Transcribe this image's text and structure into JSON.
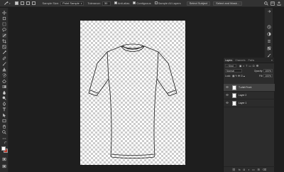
{
  "options_bar": {
    "sample_size_label": "Sample Size:",
    "sample_size_value": "Point Sample",
    "tolerance_label": "Tolerance:",
    "tolerance_value": "30",
    "anti_alias_label": "Anti-alias",
    "contiguous_label": "Contiguous",
    "sample_all_layers_label": "Sample All Layers",
    "select_subject_label": "Select Subject",
    "select_and_mask_label": "Select and Mask..."
  },
  "layers_panel": {
    "tabs": [
      {
        "label": "Layers",
        "active": true
      },
      {
        "label": "Channels",
        "active": false
      },
      {
        "label": "Paths",
        "active": false
      }
    ],
    "filter_kind": "Kind",
    "blend_mode": "Normal",
    "opacity_label": "Opacity:",
    "opacity_value": "100%",
    "lock_label": "Lock:",
    "fill_label": "Fill:",
    "fill_value": "100%",
    "layers": [
      {
        "name": "T-shirt Front",
        "selected": true
      },
      {
        "name": "Layer 2",
        "selected": false
      },
      {
        "name": "Layer 1",
        "selected": false
      }
    ],
    "bottom_icons": [
      "link-icon",
      "fx-icon",
      "mask-icon",
      "adjustment-icon",
      "folder-icon",
      "new-layer-icon",
      "trash-icon"
    ],
    "bottom_glyphs": [
      "⛓",
      "fx",
      "◘",
      "◑",
      "▭",
      "⊞",
      "⌫"
    ]
  },
  "colors": {
    "accent": "#5d93ff",
    "foreground": "#ffffff",
    "background": "#c0392b"
  }
}
